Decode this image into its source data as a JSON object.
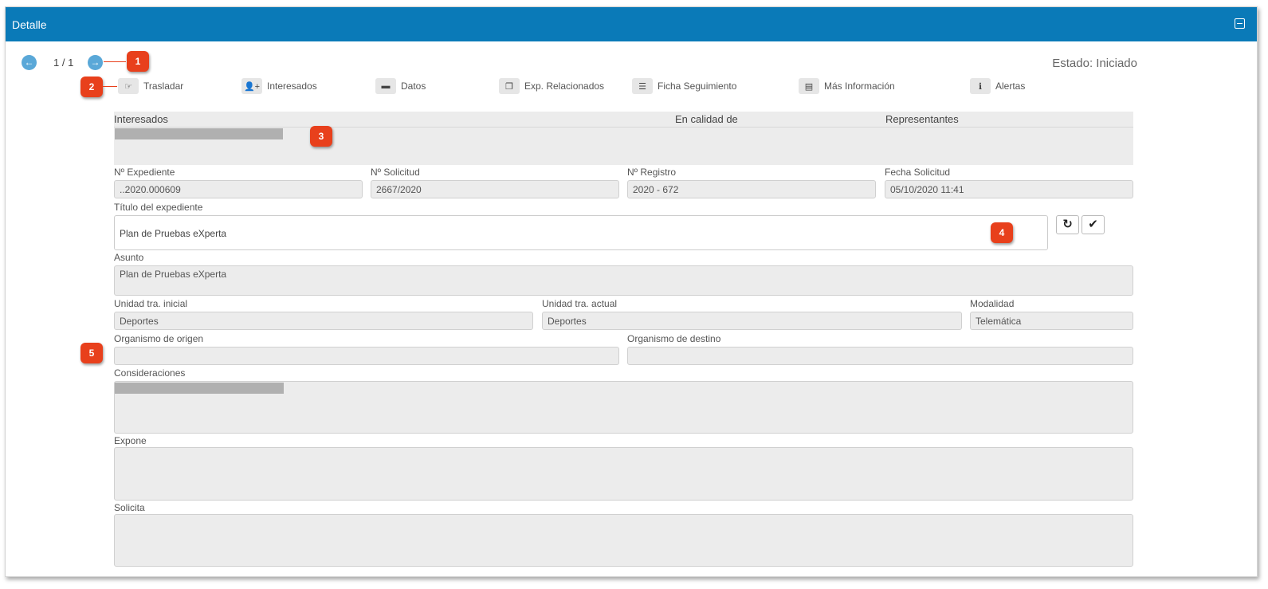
{
  "window": {
    "title": "Detalle"
  },
  "pager": {
    "text": "1 / 1"
  },
  "estado": "Estado: Iniciado",
  "toolbar": [
    {
      "label": "Trasladar",
      "icon": "thumb-right-icon"
    },
    {
      "label": "Interesados",
      "icon": "user-add-icon"
    },
    {
      "label": "Datos",
      "icon": "drive-icon"
    },
    {
      "label": "Exp. Relacionados",
      "icon": "copy-icon"
    },
    {
      "label": "Ficha Seguimiento",
      "icon": "list-icon"
    },
    {
      "label": "Más Información",
      "icon": "document-icon"
    },
    {
      "label": "Alertas",
      "icon": "info-icon"
    }
  ],
  "interesados_table": {
    "headers": [
      "Interesados",
      "En calidad de",
      "Representantes"
    ]
  },
  "fields": {
    "expediente": {
      "label": "Nº Expediente",
      "value": "..2020.000609"
    },
    "solicitud": {
      "label": "Nº Solicitud",
      "value": "2667/2020"
    },
    "registro": {
      "label": "Nº Registro",
      "value": "2020 - 672"
    },
    "fecha": {
      "label": "Fecha Solicitud",
      "value": "05/10/2020 11:41"
    },
    "titulo": {
      "label": "Título del expediente",
      "value": "Plan de Pruebas eXperta"
    },
    "asunto": {
      "label": "Asunto",
      "value": "Plan de Pruebas eXperta"
    },
    "unidad_inicial": {
      "label": "Unidad tra. inicial",
      "value": "Deportes"
    },
    "unidad_actual": {
      "label": "Unidad tra. actual",
      "value": "Deportes"
    },
    "modalidad": {
      "label": "Modalidad",
      "value": "Telemática"
    },
    "org_origen": {
      "label": "Organismo de origen",
      "value": ""
    },
    "org_destino": {
      "label": "Organismo de destino",
      "value": ""
    },
    "consideraciones": {
      "label": "Consideraciones",
      "value": ""
    },
    "expone": {
      "label": "Expone",
      "value": ""
    },
    "solicita": {
      "label": "Solicita",
      "value": ""
    }
  },
  "callouts": [
    "1",
    "2",
    "3",
    "4",
    "5"
  ],
  "colors": {
    "header": "#0a7ab8",
    "callout": "#e8401c",
    "field_bg": "#ececec"
  }
}
